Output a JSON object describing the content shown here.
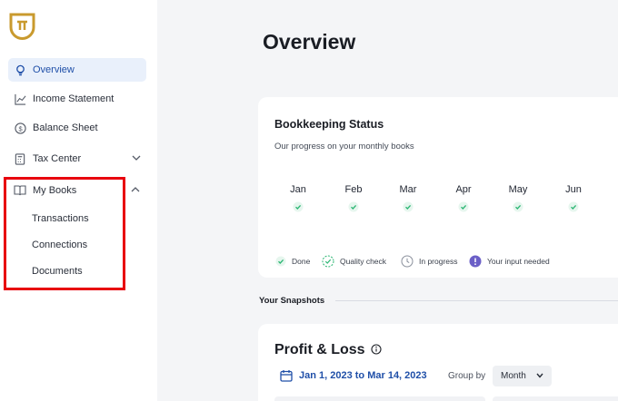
{
  "sidebar": {
    "nav": {
      "overview": "Overview",
      "income_statement": "Income Statement",
      "balance_sheet": "Balance Sheet",
      "tax_center": "Tax Center",
      "my_books": "My Books"
    },
    "my_books_items": [
      "Transactions",
      "Connections",
      "Documents"
    ]
  },
  "main": {
    "title": "Overview",
    "bookkeeping": {
      "title": "Bookkeeping Status",
      "subtitle": "Our progress on your monthly books",
      "months": [
        "Jan",
        "Feb",
        "Mar",
        "Apr",
        "May",
        "Jun"
      ],
      "legend": {
        "done": "Done",
        "quality_check": "Quality check",
        "in_progress": "In progress",
        "input_needed": "Your input needed"
      }
    },
    "snapshots_label": "Your Snapshots",
    "profit_loss": {
      "title": "Profit & Loss",
      "date_range": "Jan 1, 2023 to Mar 14, 2023",
      "group_by_label": "Group by",
      "group_by_value": "Month"
    }
  },
  "colors": {
    "accent": "#1f4fa8",
    "logo": "#c99a2e",
    "done_green": "#2bb673",
    "input_needed_purple": "#6b5fc7",
    "highlight_red": "#e8000d"
  }
}
